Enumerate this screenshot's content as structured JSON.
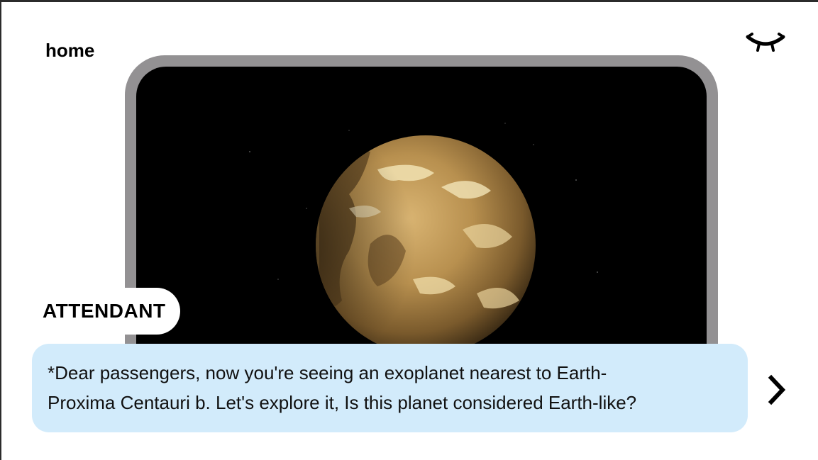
{
  "nav": {
    "home_label": "home"
  },
  "icons": {
    "visibility_toggle": "closed-eye-icon",
    "next": "chevron-right-icon"
  },
  "scene": {
    "image_subject": "Proxima Centauri b",
    "planet_color": "#b58b4a"
  },
  "dialogue": {
    "speaker": "ATTENDANT",
    "line1": "*Dear passengers, now you're seeing an exoplanet nearest to Earth-",
    "line2": "Proxima Centauri b. Let's explore it, Is this planet considered Earth-like?"
  },
  "colors": {
    "dialogue_bg": "#d2ebfb",
    "screen_frame": "#939193",
    "screen_bg": "#000000"
  }
}
